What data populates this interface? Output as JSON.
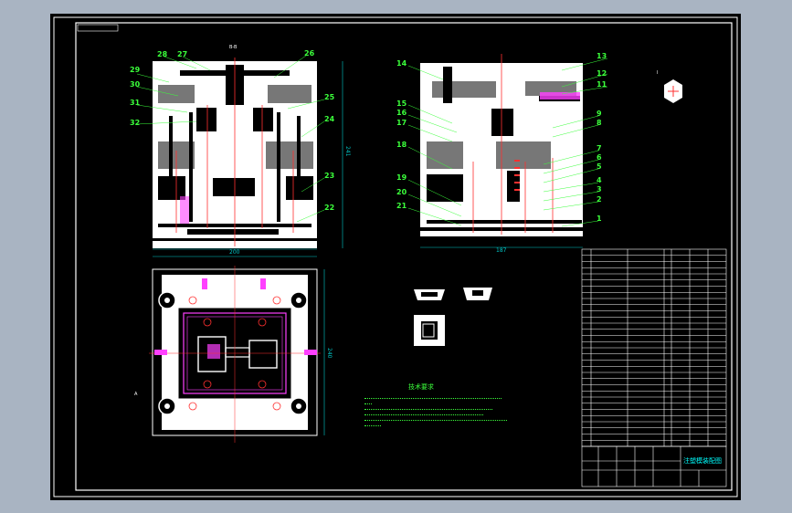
{
  "drawing": {
    "main_view_labels_left": [
      "28",
      "27",
      "26",
      "29",
      "30",
      "25",
      "31",
      "32",
      "24",
      "23",
      "22"
    ],
    "main_view_labels_right": [
      "14",
      "13",
      "12",
      "11",
      "15",
      "16",
      "17",
      "18",
      "9",
      "8",
      "7",
      "6",
      "5",
      "4",
      "3",
      "2",
      "1",
      "19",
      "20",
      "21"
    ],
    "dimensions": {
      "left_width": "200",
      "left_height": "241",
      "right_width": "187",
      "plan_height": "240"
    },
    "view_markers": {
      "section_mark": "B-B",
      "plan_mark": "A",
      "detail_mark": "I"
    },
    "technical_requirements": {
      "title": "技术要求"
    }
  },
  "title_block": {
    "title": "注塑模装配图"
  },
  "colors": {
    "background": "#000000",
    "frame": "#ffffff",
    "labels": "#3bff3b",
    "red": "#ff3030",
    "magenta": "#ff40ff",
    "cyan": "#00c8c8"
  }
}
